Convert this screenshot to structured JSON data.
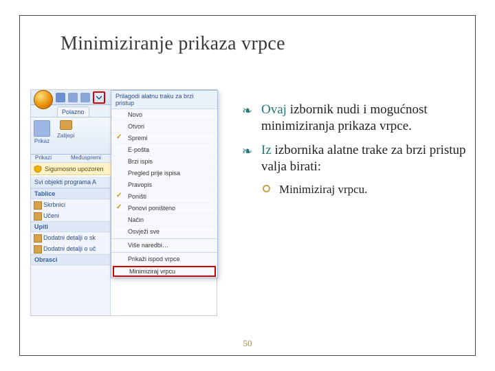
{
  "slide": {
    "title": "Minimiziranje prikaza vrpce",
    "page_number": "50"
  },
  "body": {
    "b1_lead": "Ovaj",
    "b1_rest": " izbornik nudi i mogućnost minimiziranja prikaza vrpce.",
    "b2_lead": "Iz",
    "b2_rest": " izbornika alatne trake za brzi pristup valja birati:",
    "sub1": "Minimiziraj vrpcu."
  },
  "screenshot": {
    "ribbon": {
      "tab_home": "Polazno",
      "group_view": "Prikaz",
      "group_paste": "Zalijepi",
      "section_views": "Prikazi",
      "section_clipboard": "Međuspremi"
    },
    "warning": "Sigurnosno upozoren",
    "nav": {
      "all_objects": "Svi objekti programa A",
      "cat_tables": "Tablice",
      "t1": "Skrbnici",
      "t2": "Učeni",
      "cat_queries": "Upiti",
      "q1": "Dodatni detalji o sk",
      "q2": "Dodatni detalji o uč",
      "cat_forms": "Obrasci"
    },
    "dropdown": {
      "title": "Prilagodi alatnu traku za brzi pristup",
      "items": {
        "new": "Novo",
        "open": "Otvori",
        "save": "Spremi",
        "email": "E-pošta",
        "quickprint": "Brzi ispis",
        "preview": "Pregled prije ispisa",
        "spelling": "Pravopis",
        "undo": "Poništi",
        "redo": "Ponovi poništeno",
        "mode": "Način",
        "refresh": "Osvježi sve",
        "more": "Više naredbi…",
        "below": "Prikaži ispod vrpce",
        "minimize": "Minimiziraj vrpcu"
      }
    }
  }
}
